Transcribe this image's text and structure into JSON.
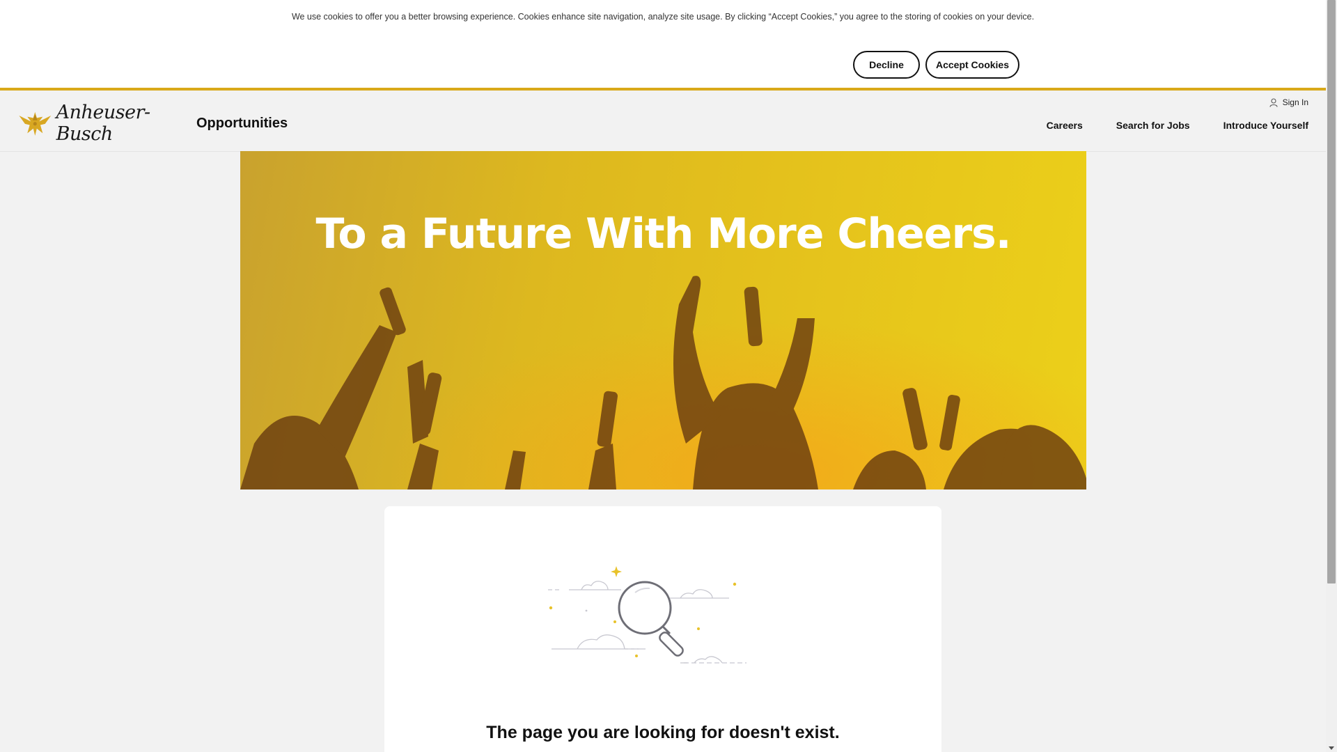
{
  "cookie_banner": {
    "text": "We use cookies to offer you a better browsing experience. Cookies enhance site navigation, analyze site usage. By clicking “Accept Cookies,” you agree to the storing of cookies on your device.",
    "decline_label": "Decline",
    "accept_label": "Accept Cookies"
  },
  "header": {
    "logo_text": "Anheuser-Busch",
    "title": "Opportunities",
    "signin_label": "Sign In",
    "nav": [
      "Careers",
      "Search for Jobs",
      "Introduce Yourself"
    ]
  },
  "hero": {
    "heading": "To a Future With More Cheers."
  },
  "error_card": {
    "message": "The page you are looking for doesn't exist."
  },
  "colors": {
    "accent_gold": "#d9a91a",
    "hero_yellow": "#e4c11c"
  },
  "icons": [
    "eagle-logo-icon",
    "user-icon",
    "magnifier-illustration-icon",
    "down-arrow-icon"
  ]
}
